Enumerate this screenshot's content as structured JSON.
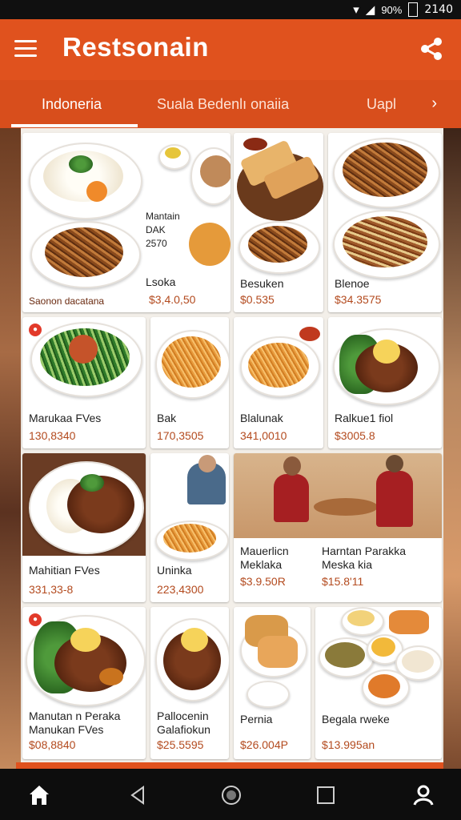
{
  "status_bar": {
    "time": "2140",
    "signal": "90%"
  },
  "app_bar": {
    "title": "Restsonain"
  },
  "tabs": [
    {
      "label": "Indoneria"
    },
    {
      "label": "Suala Bedenlı onaiia"
    },
    {
      "label": "Uapl"
    }
  ],
  "cards": [
    {
      "name": "Lsoka",
      "price": "$3,4.0,50",
      "extra_name": "Mantain\nDAK\n2570",
      "sub": "Saonon dacatana"
    },
    {
      "name": "Besuken",
      "price": "$0.535"
    },
    {
      "name": "Blenoe",
      "price": "$34.3575"
    },
    {
      "name": "Marukaa FVes",
      "price": "130,8340"
    },
    {
      "name": "Bak",
      "price": "170,3505"
    },
    {
      "name": "Blalunak",
      "price": "341,0010"
    },
    {
      "name": "Ralkue1 fiol",
      "price": "$3005.8"
    },
    {
      "name": "Mahitian FVes",
      "price": "331,33-8"
    },
    {
      "name": "Uninka",
      "price": "223,4300"
    },
    {
      "name": "Mauerlicn\nMeklaka",
      "price": "$3.9.50R"
    },
    {
      "name": "Harntan Parakka\nMeska kia",
      "price": "$15.8'11"
    },
    {
      "name": "Manutan n Peraka\nManukan FVes",
      "price": "$08,8840"
    },
    {
      "name": "Pallocenin\nGalafiokun",
      "price": "$25.5595"
    },
    {
      "name": "Pernia",
      "price": "$26.004P"
    },
    {
      "name": "Begala rweke",
      "price": "$13.995an"
    }
  ],
  "colors": {
    "accent": "#e0521e",
    "price": "#b34a1e"
  }
}
